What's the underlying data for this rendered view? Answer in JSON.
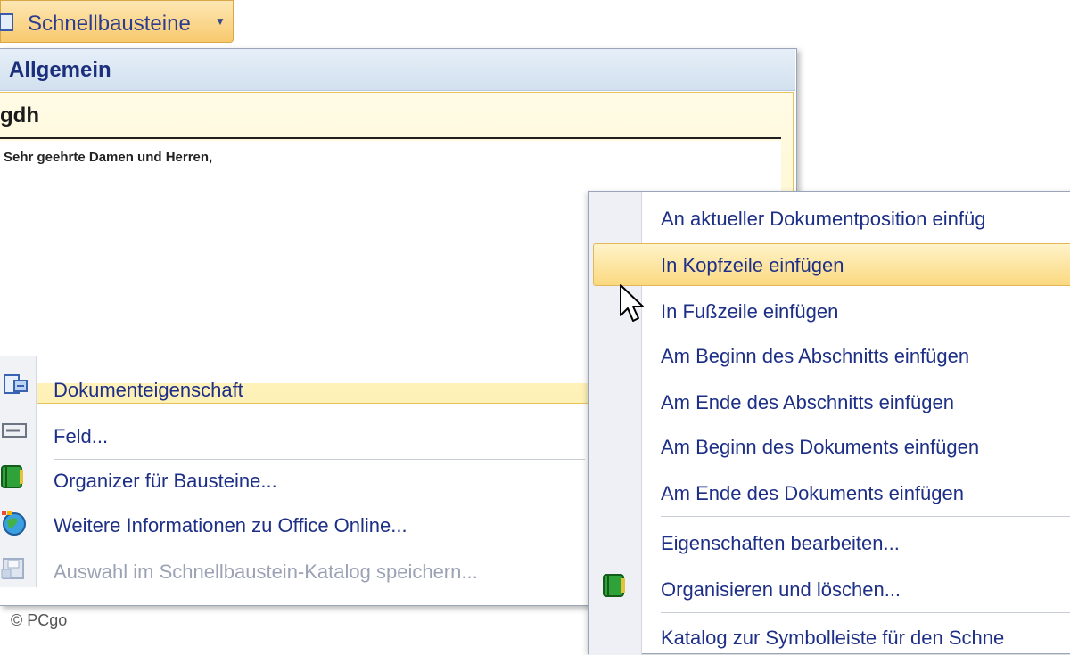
{
  "ribbon": {
    "button_label": "Schnellbausteine"
  },
  "gallery": {
    "category": "Allgemein",
    "entry_name": "gdh",
    "entry_preview": "Sehr geehrte Damen und Herren,"
  },
  "menu": {
    "items": [
      {
        "label": "Dokumenteigenschaft",
        "icon": "document-property-icon",
        "enabled": true
      },
      {
        "label": "Feld...",
        "icon": "field-icon",
        "enabled": true
      },
      {
        "label": "Organizer für Bausteine...",
        "icon": "organizer-icon",
        "enabled": true
      },
      {
        "label": "Weitere Informationen zu Office Online...",
        "icon": "office-online-globe-icon",
        "enabled": true
      },
      {
        "label": "Auswahl im Schnellbaustein-Katalog speichern...",
        "icon": "save-selection-icon",
        "enabled": false
      }
    ]
  },
  "submenu": {
    "items": [
      {
        "label": "An aktueller Dokumentposition einfüg",
        "highlighted": false
      },
      {
        "label": "In Kopfzeile einfügen",
        "highlighted": true
      },
      {
        "label": "In Fußzeile einfügen",
        "highlighted": false
      },
      {
        "label": "Am Beginn des Abschnitts einfügen",
        "highlighted": false
      },
      {
        "label": "Am Ende des Abschnitts einfügen",
        "highlighted": false
      },
      {
        "label": "Am Beginn des Dokuments einfügen",
        "highlighted": false
      },
      {
        "label": "Am Ende des Dokuments einfügen",
        "highlighted": false
      },
      {
        "label": "Eigenschaften bearbeiten...",
        "highlighted": false
      },
      {
        "label": "Organisieren und löschen...",
        "highlighted": false
      },
      {
        "label": "Katalog zur Symbolleiste für den Schne",
        "highlighted": false
      }
    ]
  },
  "watermark": "© PCgo",
  "colors": {
    "accent_highlight": "#fbd97f",
    "menu_text": "#1d2f86",
    "disabled_text": "#9aa2b4",
    "header_bg": "#d2e0ef"
  }
}
